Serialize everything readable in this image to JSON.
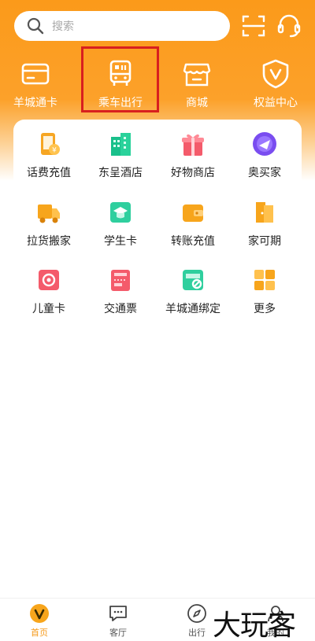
{
  "search": {
    "placeholder": "搜索"
  },
  "quick_nav": [
    {
      "label": "羊城通卡",
      "icon": "card-icon"
    },
    {
      "label": "乘车出行",
      "icon": "bus-icon",
      "highlighted": true
    },
    {
      "label": "商城",
      "icon": "store-icon"
    },
    {
      "label": "权益中心",
      "icon": "shield-v-icon"
    }
  ],
  "services": [
    {
      "label": "话费充值",
      "icon": "phone-recharge-icon"
    },
    {
      "label": "东呈酒店",
      "icon": "hotel-icon"
    },
    {
      "label": "好物商店",
      "icon": "gift-icon"
    },
    {
      "label": "奥买家",
      "icon": "shopping-icon"
    },
    {
      "label": "拉货搬家",
      "icon": "truck-icon"
    },
    {
      "label": "学生卡",
      "icon": "student-card-icon"
    },
    {
      "label": "转账充值",
      "icon": "wallet-icon"
    },
    {
      "label": "家可期",
      "icon": "home-icon"
    },
    {
      "label": "儿童卡",
      "icon": "child-card-icon"
    },
    {
      "label": "交通票",
      "icon": "ticket-icon"
    },
    {
      "label": "羊城通绑定",
      "icon": "link-card-icon"
    },
    {
      "label": "更多",
      "icon": "more-grid-icon"
    }
  ],
  "tabbar": [
    {
      "label": "首页",
      "icon": "home-v-icon",
      "active": true
    },
    {
      "label": "客厅",
      "icon": "chat-icon",
      "active": false
    },
    {
      "label": "出行",
      "icon": "compass-icon",
      "active": false
    },
    {
      "label": "我的",
      "icon": "user-icon",
      "active": false
    }
  ],
  "watermark": "大玩客",
  "colors": {
    "brand_orange": "#fb9a1a",
    "highlight_red": "#d81f1f",
    "active_tab": "#f59a1b"
  }
}
